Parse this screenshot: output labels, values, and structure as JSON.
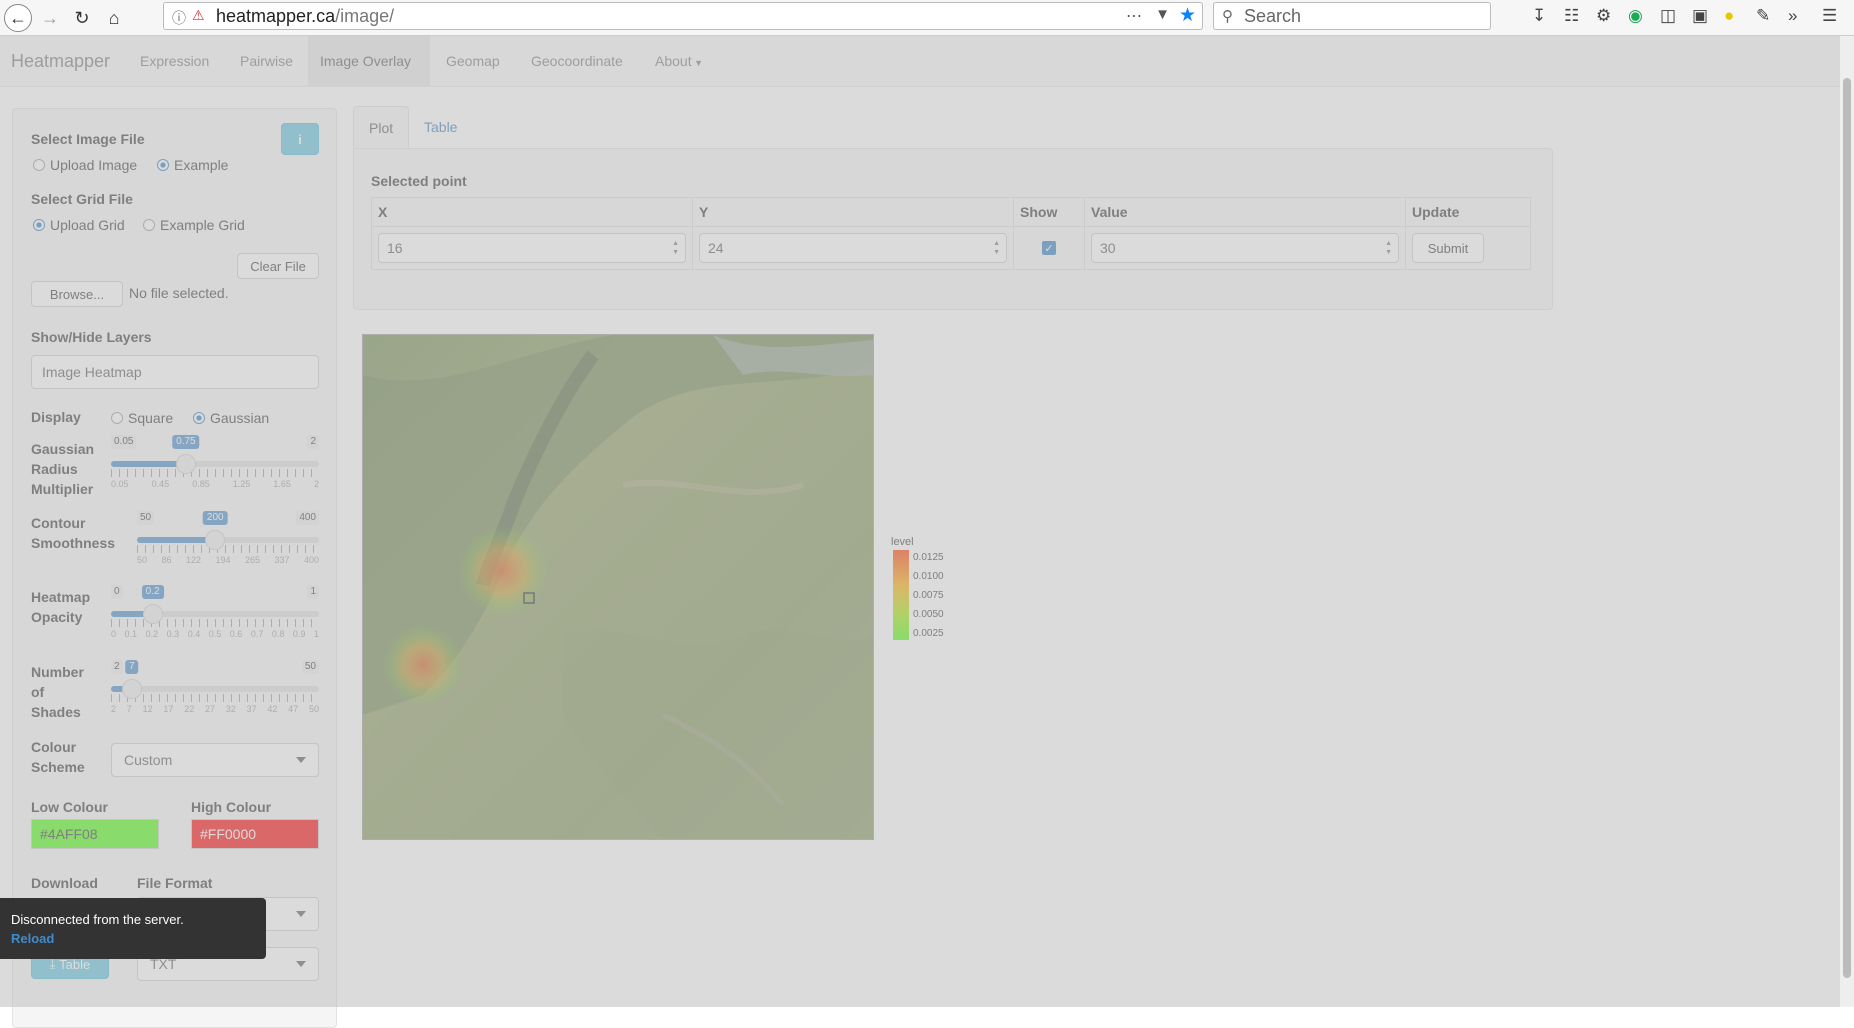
{
  "browser": {
    "url_host": "heatmapper.ca",
    "url_path": "/image/",
    "search_placeholder": "Search"
  },
  "navbar": {
    "brand": "Heatmapper",
    "items": [
      {
        "label": "Expression"
      },
      {
        "label": "Pairwise"
      },
      {
        "label": "Image Overlay"
      },
      {
        "label": "Geomap"
      },
      {
        "label": "Geocoordinate"
      },
      {
        "label": "About"
      }
    ],
    "active": "Image Overlay"
  },
  "sidebar": {
    "select_image_label": "Select Image File",
    "image_opt_upload": "Upload Image",
    "image_opt_example": "Example",
    "info_icon": "i",
    "select_grid_label": "Select Grid File",
    "grid_opt_upload": "Upload Grid",
    "grid_opt_example": "Example Grid",
    "clear_file": "Clear File",
    "browse": "Browse...",
    "no_file": "No file selected.",
    "layers_label": "Show/Hide Layers",
    "layers_value": "Image  Heatmap",
    "display_label": "Display",
    "display_square": "Square",
    "display_gaussian": "Gaussian",
    "gauss_label_1": "Gaussian",
    "gauss_label_2": "Radius",
    "gauss_label_3": "Multiplier",
    "gauss": {
      "min": "0.05",
      "max": "2",
      "value": "0.75",
      "fraction": 0.36,
      "ticks": [
        "0.05",
        "0.45",
        "0.85",
        "1.25",
        "1.65",
        "2"
      ]
    },
    "contour_label_1": "Contour",
    "contour_label_2": "Smoothness",
    "contour": {
      "min": "50",
      "max": "400",
      "value": "200",
      "fraction": 0.43,
      "ticks": [
        "50",
        "86",
        "122",
        "194",
        "265",
        "337",
        "400"
      ]
    },
    "opacity_label_1": "Heatmap",
    "opacity_label_2": "Opacity",
    "opacity": {
      "min": "0",
      "max": "1",
      "value": "0.2",
      "fraction": 0.2,
      "ticks": [
        "0",
        "0.1",
        "0.2",
        "0.3",
        "0.4",
        "0.5",
        "0.6",
        "0.7",
        "0.8",
        "0.9",
        "1"
      ]
    },
    "shades_label_1": "Number",
    "shades_label_2": "of",
    "shades_label_3": "Shades",
    "shades": {
      "min": "2",
      "max": "50",
      "value": "7",
      "fraction": 0.1,
      "ticks": [
        "2",
        "7",
        "12",
        "17",
        "22",
        "27",
        "32",
        "37",
        "42",
        "47",
        "50"
      ]
    },
    "colour_scheme_label_1": "Colour",
    "colour_scheme_label_2": "Scheme",
    "colour_scheme_value": "Custom",
    "low_colour_label": "Low Colour",
    "low_colour_value": "#4AFF08",
    "high_colour_label": "High Colour",
    "high_colour_value": "#FF0000",
    "download_label": "Download",
    "file_format_label": "File Format",
    "table_button": "Table",
    "file_format_value": "TXT"
  },
  "main": {
    "tab_plot": "Plot",
    "tab_table": "Table",
    "selected_point_label": "Selected point",
    "headers": {
      "x": "X",
      "y": "Y",
      "show": "Show",
      "value": "Value",
      "update": "Update"
    },
    "row": {
      "x": "16",
      "y": "24",
      "value": "30",
      "submit": "Submit"
    }
  },
  "legend": {
    "title": "level",
    "labels": [
      "0.0125",
      "0.0100",
      "0.0075",
      "0.0050",
      "0.0025"
    ]
  },
  "toast": {
    "message": "Disconnected from the server.",
    "reload": "Reload"
  },
  "colors": {
    "low": "#4AFF08",
    "high": "#FF0000",
    "link": "#337ab7"
  }
}
